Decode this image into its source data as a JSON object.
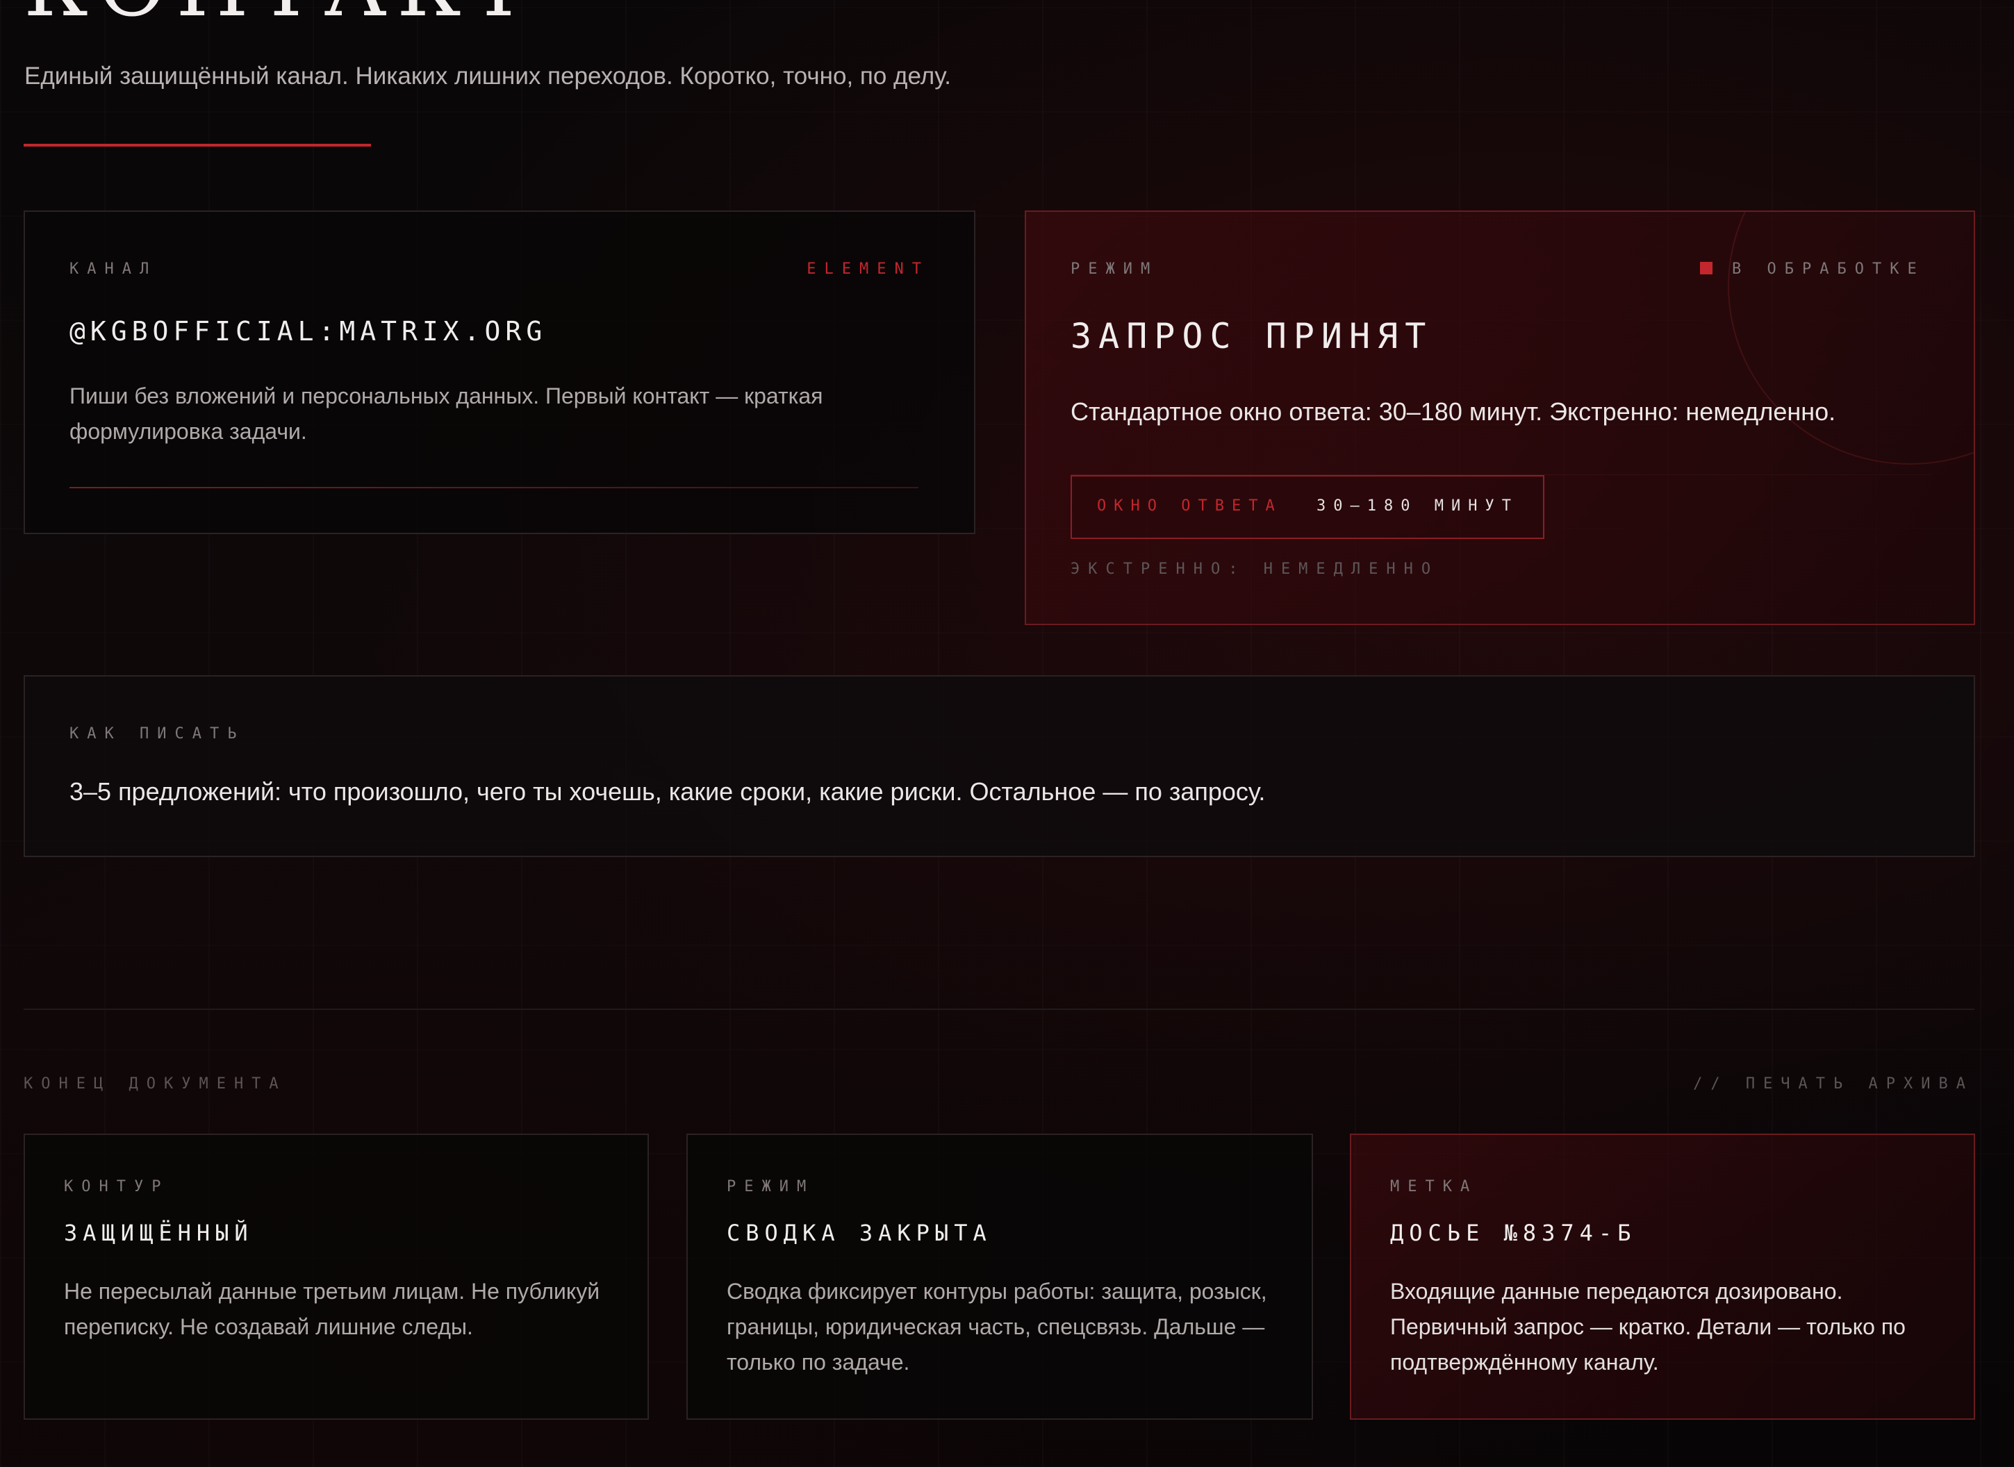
{
  "header": {
    "title": "КОНТАКТ",
    "subtitle": "Единый защищённый канал. Никаких лишних переходов. Коротко, точно, по делу."
  },
  "channel_card": {
    "label": "КАНАЛ",
    "tag": "ELEMENT",
    "address": "@KGBOFFICIAL:MATRIX.ORG",
    "description": "Пиши без вложений и персональных данных. Первый контакт — краткая формулировка задачи."
  },
  "mode_card": {
    "label": "РЕЖИМ",
    "status": "В ОБРАБОТКЕ",
    "heading": "ЗАПРОС ПРИНЯТ",
    "description": "Стандартное окно ответа: 30–180 минут. Экстренно: немедленно.",
    "response_window_label": "ОКНО ОТВЕТА",
    "response_window_value": "30–180 МИНУТ",
    "urgent": "ЭКСТРЕННО: НЕМЕДЛЕННО"
  },
  "howto_card": {
    "label": "КАК ПИСАТЬ",
    "text": "3–5 предложений: что произошло, чего ты хочешь, какие сроки, какие риски. Остальное — по запросу."
  },
  "footer": {
    "left_label": "КОНЕЦ ДОКУМЕНТА",
    "right_label": "// ПЕЧАТЬ АРХИВА",
    "cards": [
      {
        "label": "КОНТУР",
        "heading": "ЗАЩИЩЁННЫЙ",
        "text": "Не пересылай данные третьим лицам. Не публикуй переписку. Не создавай лишние следы."
      },
      {
        "label": "РЕЖИМ",
        "heading": "СВОДКА ЗАКРЫТА",
        "text": "Сводка фиксирует контуры работы: защита, розыск, границы, юридическая часть, спецсвязь. Дальше — только по задаче."
      },
      {
        "label": "МЕТКА",
        "heading": "ДОСЬЕ №8374-Б",
        "text": "Входящие данные передаются дозировано. Первичный запрос — кратко. Детали — только по подтверждённому каналу."
      }
    ]
  },
  "colors": {
    "accent": "#c1272d",
    "background": "#070506",
    "muted_text": "#b0a9aa"
  }
}
